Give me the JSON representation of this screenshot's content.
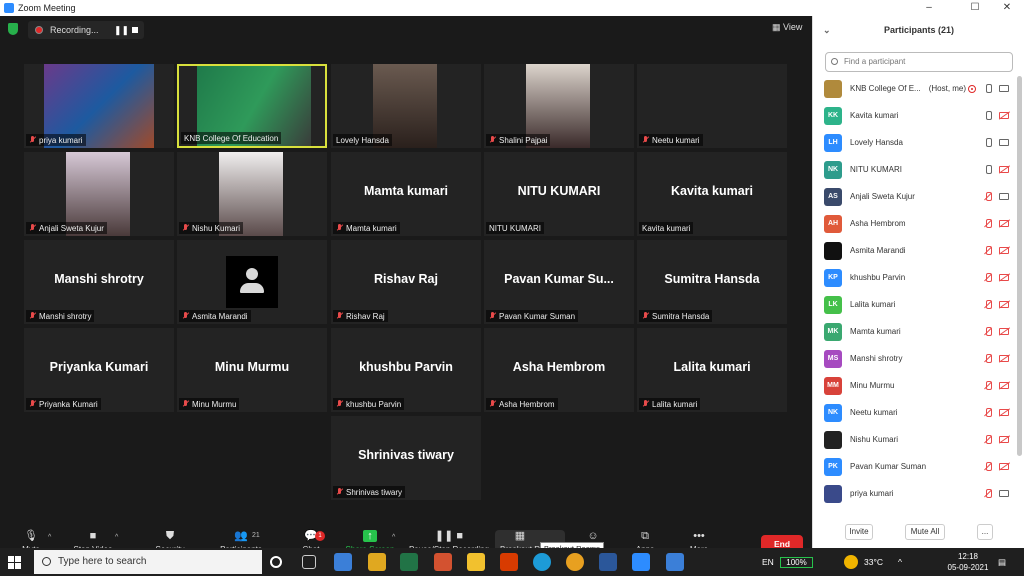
{
  "window": {
    "title": "Zoom Meeting",
    "controls": [
      "–",
      "☐",
      "✕"
    ]
  },
  "recording": {
    "label": "Recording...",
    "pause_icon": "pause-icon",
    "stop_icon": "stop-icon"
  },
  "view_button": "View",
  "tiles": [
    {
      "name": "priya kumari",
      "video": true,
      "muted": true
    },
    {
      "name": "KNB College Of Education",
      "video": true,
      "muted": false,
      "active": true
    },
    {
      "name": "Lovely Hansda",
      "video": true,
      "muted": false
    },
    {
      "name": "Shalini Pajpai",
      "video": true,
      "muted": true
    },
    {
      "name": "Neetu kumari",
      "video": false,
      "muted": true
    },
    {
      "name": "Anjali Sweta Kujur",
      "video": true,
      "muted": true
    },
    {
      "name": "Nishu Kumari",
      "video": true,
      "muted": true
    },
    {
      "name": "Mamta kumari",
      "big": "Mamta kumari",
      "video": false,
      "muted": true
    },
    {
      "name": "NITU KUMARI",
      "big": "NITU KUMARI",
      "video": false,
      "muted": false
    },
    {
      "name": "Kavita kumari",
      "big": "Kavita kumari",
      "video": false,
      "muted": false
    },
    {
      "name": "Manshi shrotry",
      "big": "Manshi shrotry",
      "video": false,
      "muted": true
    },
    {
      "name": "Asmita Marandi",
      "video": false,
      "muted": true,
      "avatar": true
    },
    {
      "name": "Rishav Raj",
      "big": "Rishav Raj",
      "video": false,
      "muted": true
    },
    {
      "name": "Pavan Kumar Suman",
      "big": "Pavan Kumar Su...",
      "video": false,
      "muted": true
    },
    {
      "name": "Sumitra Hansda",
      "big": "Sumitra Hansda",
      "video": false,
      "muted": true
    },
    {
      "name": "Priyanka Kumari",
      "big": "Priyanka Kumari",
      "video": false,
      "muted": true
    },
    {
      "name": "Minu Murmu",
      "big": "Minu Murmu",
      "video": false,
      "muted": true
    },
    {
      "name": "khushbu Parvin",
      "big": "khushbu Parvin",
      "video": false,
      "muted": true
    },
    {
      "name": "Asha Hembrom",
      "big": "Asha Hembrom",
      "video": false,
      "muted": true
    },
    {
      "name": "Lalita kumari",
      "big": "Lalita kumari",
      "video": false,
      "muted": true
    },
    {
      "name": "Shrinivas tiwary",
      "big": "Shrinivas tiwary",
      "video": false,
      "muted": true
    }
  ],
  "toolbar": {
    "mute": "Mute",
    "stop_video": "Stop Video",
    "security": "Security",
    "participants": "Participants",
    "participants_count": "21",
    "chat": "Chat",
    "chat_badge": "1",
    "share_screen": "Share Screen",
    "recording": "Pause/Stop Recording",
    "breakout": "Breakout R",
    "breakout_tooltip": "Breakout Rooms",
    "reactions": "s",
    "apps": "Apps",
    "more": "More",
    "end": "End"
  },
  "panel": {
    "title": "Participants (21)",
    "search_placeholder": "Find a participant",
    "participants": [
      {
        "name": "KNB College Of E...",
        "suffix": "(Host, me)",
        "initials": "",
        "color": "#b08a3c",
        "mic": "on",
        "cam": "on",
        "recording": true
      },
      {
        "name": "Kavita kumari",
        "initials": "KK",
        "color": "#2db38a",
        "mic": "on",
        "cam": "off"
      },
      {
        "name": "Lovely Hansda",
        "initials": "LH",
        "color": "#2d8cff",
        "mic": "on",
        "cam": "on"
      },
      {
        "name": "NITU KUMARI",
        "initials": "NK",
        "color": "#2d9c8c",
        "mic": "on",
        "cam": "off"
      },
      {
        "name": "Anjali Sweta Kujur",
        "initials": "AS",
        "color": "#3a4a6b",
        "mic": "muted",
        "cam": "on"
      },
      {
        "name": "Asha Hembrom",
        "initials": "AH",
        "color": "#e05a3a",
        "mic": "muted",
        "cam": "off"
      },
      {
        "name": "Asmita Marandi",
        "initials": "",
        "color": "#111111",
        "mic": "muted",
        "cam": "off"
      },
      {
        "name": "khushbu Parvin",
        "initials": "KP",
        "color": "#2d8cff",
        "mic": "muted",
        "cam": "off"
      },
      {
        "name": "Lalita kumari",
        "initials": "LK",
        "color": "#45c04a",
        "mic": "muted",
        "cam": "off"
      },
      {
        "name": "Mamta kumari",
        "initials": "MK",
        "color": "#3aa870",
        "mic": "muted",
        "cam": "off"
      },
      {
        "name": "Manshi shrotry",
        "initials": "MS",
        "color": "#a64ac0",
        "mic": "muted",
        "cam": "off"
      },
      {
        "name": "Minu Murmu",
        "initials": "MM",
        "color": "#d8423a",
        "mic": "muted",
        "cam": "off"
      },
      {
        "name": "Neetu kumari",
        "initials": "NK",
        "color": "#2d8cff",
        "mic": "muted",
        "cam": "off"
      },
      {
        "name": "Nishu Kumari",
        "initials": "",
        "color": "#222222",
        "mic": "muted",
        "cam": "off"
      },
      {
        "name": "Pavan Kumar Suman",
        "initials": "PK",
        "color": "#2d8cff",
        "mic": "muted",
        "cam": "off"
      },
      {
        "name": "priya kumari",
        "initials": "",
        "color": "#3a4a8a",
        "mic": "muted",
        "cam": "on"
      }
    ],
    "invite": "Invite",
    "mute_all": "Mute All",
    "more": "..."
  },
  "taskbar": {
    "search_placeholder": "Type here to search",
    "lang": "EN",
    "battery": "100%",
    "weather": "33°C",
    "time": "12:18",
    "date": "05-09-2021"
  }
}
